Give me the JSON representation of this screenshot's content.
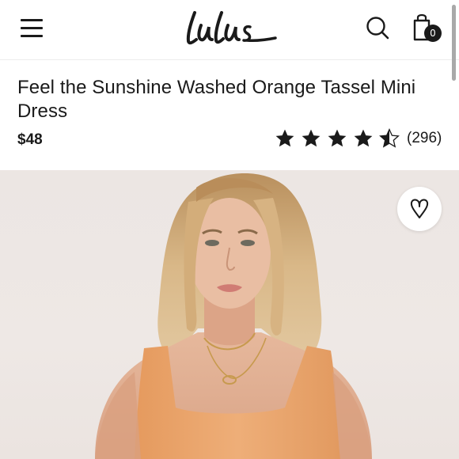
{
  "header": {
    "logo_text": "Lulus",
    "menu_icon": "hamburger-menu-icon",
    "search_icon": "search-icon",
    "bag_icon": "shopping-bag-icon",
    "bag_count": "0"
  },
  "product": {
    "title": "Feel the Sunshine Washed Orange Tassel Mini Dress",
    "price": "$48",
    "rating": {
      "value": 4.5,
      "max": 5,
      "review_count": "(296)"
    },
    "favorite_icon": "heart-icon"
  },
  "colors": {
    "text": "#1a1a1a",
    "dress": "#e9a46c",
    "background": "#ffffff"
  }
}
